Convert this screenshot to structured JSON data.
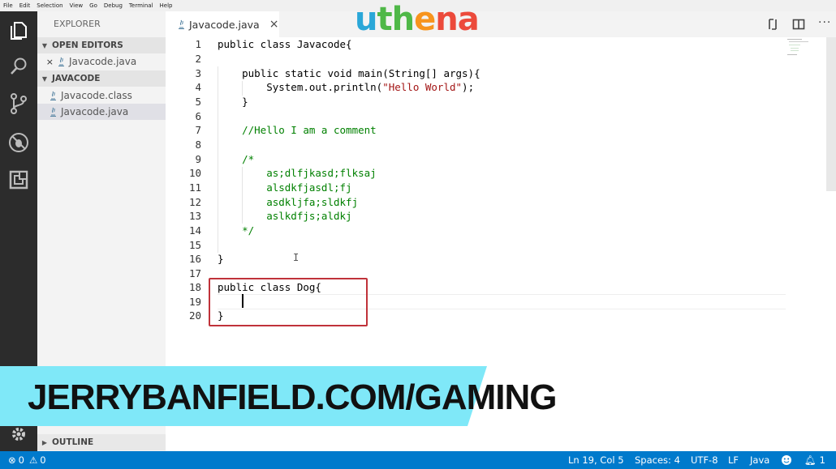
{
  "menu": [
    "File",
    "Edit",
    "Selection",
    "View",
    "Go",
    "Debug",
    "Terminal",
    "Help"
  ],
  "logo_text": "uthena",
  "sidebar": {
    "title": "EXPLORER",
    "open_editors_label": "OPEN EDITORS",
    "open_editors": [
      {
        "name": "Javacode.java"
      }
    ],
    "folder_label": "JAVACODE",
    "files": [
      {
        "name": "Javacode.class"
      },
      {
        "name": "Javacode.java"
      }
    ],
    "outline_label": "OUTLINE"
  },
  "tab": {
    "label": "Javacode.java",
    "close": "×"
  },
  "editor": {
    "line_numbers": [
      "1",
      "2",
      "3",
      "4",
      "5",
      "6",
      "7",
      "8",
      "9",
      "10",
      "11",
      "12",
      "13",
      "14",
      "15",
      "16",
      "17",
      "18",
      "19",
      "20"
    ],
    "lines": {
      "l1": "public class Javacode{",
      "l3": "    public static void main(String[] args){",
      "l4_pre": "        System.out.println(",
      "l4_str": "\"Hello World\"",
      "l4_post": ");",
      "l5": "    }",
      "l7": "    //Hello I am a comment",
      "l9": "    /*",
      "l10": "        as;dlfjkasd;flksaj",
      "l11": "        alsdkfjasdl;fj",
      "l12": "        asdkljfa;sldkfj",
      "l13": "        aslkdfjs;aldkj",
      "l14": "    */",
      "l16": "}",
      "l18": "public class Dog{",
      "l20": "}"
    }
  },
  "banner": {
    "text": "JERRYBANFIELD.COM/GAMING"
  },
  "status": {
    "errors": "0",
    "warnings": "0",
    "position": "Ln 19, Col 5",
    "spaces": "Spaces: 4",
    "encoding": "UTF-8",
    "eol": "LF",
    "language": "Java",
    "notifications": "1"
  },
  "colors": {
    "accent": "#007acc",
    "banner": "#7fe8f8",
    "highlight_box": "#c0323a"
  }
}
